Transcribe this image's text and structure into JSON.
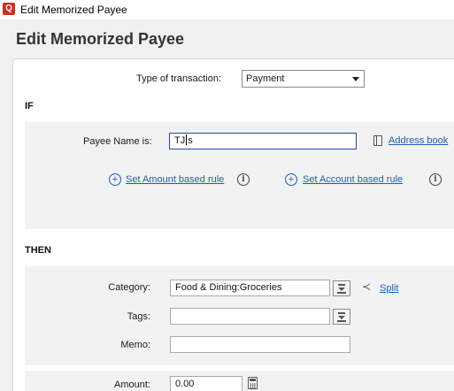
{
  "window": {
    "title": "Edit Memorized Payee",
    "app_icon_letter": "Q"
  },
  "page": {
    "title": "Edit Memorized Payee"
  },
  "transaction_type": {
    "label": "Type of transaction:",
    "value": "Payment"
  },
  "if_section": {
    "heading": "IF",
    "payee_label": "Payee Name is:",
    "payee_value_before_caret": "TJ",
    "payee_value_after_caret": "s",
    "address_book_link": "Address book",
    "amount_rule_link": "Set Amount based rule",
    "account_rule_link": "Set Account based rule"
  },
  "then_section": {
    "heading": "THEN",
    "category_label": "Category:",
    "category_value": "Food & Dining:Groceries",
    "split_link": "Split",
    "tags_label": "Tags:",
    "tags_value": "",
    "memo_label": "Memo:",
    "memo_value": "",
    "amount_label": "Amount:",
    "amount_value": "0.00"
  },
  "icons": {
    "plus": "+",
    "info": "i",
    "split": "≺"
  },
  "colors": {
    "accent": "#d52b1e",
    "link": "#1a5fb4"
  }
}
